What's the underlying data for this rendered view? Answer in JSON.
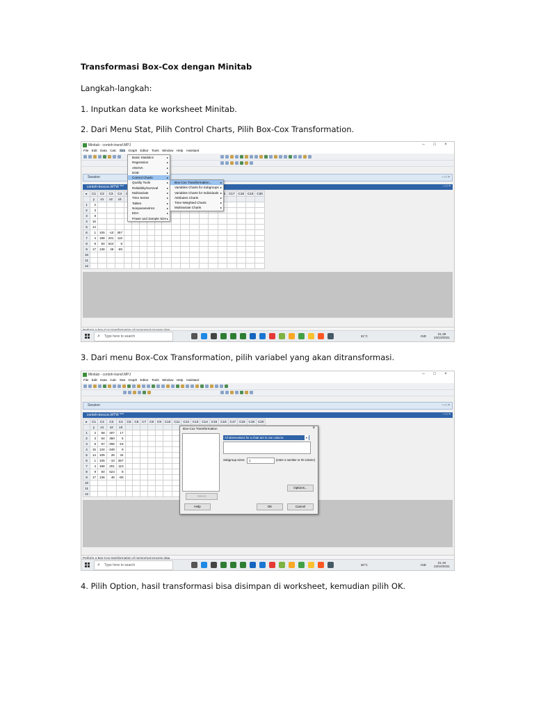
{
  "doc": {
    "title": "Transformasi Box-Cox dengan Minitab",
    "subtitle": "Langkah-langkah:",
    "step1": "1. Inputkan data ke worksheet Minitab.",
    "step2": "2. Dari Menu Stat, Pilih Control Charts, Pilih Box-Cox Transformation.",
    "step3": "3. Dari menu Box-Cox Transformation, pilih variabel yang akan ditransformasi.",
    "step4": "4. Pilih Option, hasil transformasi bisa disimpan di worksheet, kemudian pilih OK."
  },
  "app": {
    "window_title": "Minitab - contoh-transf.MPJ",
    "menu": [
      "File",
      "Edit",
      "Data",
      "Calc",
      "Stat",
      "Graph",
      "Editor",
      "Tools",
      "Window",
      "Help",
      "Assistant"
    ],
    "session_title": "Session",
    "worksheet_title": "contoh-boxcox.MTW ***",
    "status_text": "Perform a Box-Cox transformation of nonnormal process data",
    "search_placeholder": "Type here to search",
    "lang": "IND"
  },
  "screenshot1": {
    "columns": [
      "C1",
      "C2",
      "C3",
      "C4",
      "C5",
      "C6",
      "C7",
      "C8",
      "C9",
      "C10",
      "C11",
      "C12",
      "C13",
      "C14",
      "C15",
      "C16",
      "C17",
      "C18",
      "C19",
      "C20"
    ],
    "col_names": [
      "y",
      "x1",
      "x2",
      "x3"
    ],
    "rows": [
      [
        "1",
        "2",
        "",
        "",
        ""
      ],
      [
        "2",
        "3",
        "",
        "",
        ""
      ],
      [
        "3",
        "8",
        "",
        "",
        ""
      ],
      [
        "4",
        "15",
        "",
        "",
        ""
      ],
      [
        "5",
        "14",
        "",
        "",
        ""
      ],
      [
        "6",
        "1",
        "105",
        "-10",
        "357"
      ],
      [
        "7",
        "4",
        "188",
        "201",
        "110"
      ],
      [
        "8",
        "9",
        "50",
        "524",
        "8"
      ],
      [
        "9",
        "17",
        "136",
        "46",
        "-80"
      ],
      [
        "10",
        "",
        "",
        "",
        ""
      ],
      [
        "11",
        "",
        "",
        "",
        ""
      ],
      [
        "12",
        "",
        "",
        "",
        ""
      ]
    ],
    "stat_menu": [
      "Basic Statistics",
      "Regression",
      "ANOVA",
      "DOE",
      "Control Charts",
      "Quality Tools",
      "Reliability/Survival",
      "Multivariate",
      "Time Series",
      "Tables",
      "Nonparametrics",
      "EDA",
      "Power and Sample Size"
    ],
    "control_charts_menu": [
      "Box-Cox Transformation...",
      "Variables Charts for Subgroups",
      "Variables Charts for Individuals",
      "Attributes Charts",
      "Time-Weighted Charts",
      "Multivariate Charts"
    ],
    "weather": "31°C",
    "time": "01.38",
    "date": "23/10/2021"
  },
  "screenshot2": {
    "rows": [
      [
        "1",
        "2",
        "58",
        "407",
        "17"
      ],
      [
        "2",
        "3",
        "84",
        "360",
        "5"
      ],
      [
        "3",
        "8",
        "87",
        "-306",
        "-15"
      ],
      [
        "4",
        "15",
        "134",
        "-349",
        "9"
      ],
      [
        "5",
        "14",
        "106",
        "26",
        "34"
      ],
      [
        "6",
        "1",
        "105",
        "-10",
        "357"
      ],
      [
        "7",
        "4",
        "188",
        "201",
        "110"
      ],
      [
        "8",
        "9",
        "50",
        "524",
        "8"
      ],
      [
        "9",
        "17",
        "136",
        "46",
        "-80"
      ],
      [
        "10",
        "",
        "",
        "",
        ""
      ],
      [
        "11",
        "",
        "",
        "",
        ""
      ],
      [
        "12",
        "",
        "",
        "",
        ""
      ]
    ],
    "dialog": {
      "title": "Box-Cox Transformation",
      "dropdown_value": "All observations for a chart are in one column:",
      "subgroup_label": "Subgroup sizes:",
      "subgroup_value": "1",
      "subgroup_hint": "(enter a number or ID column)",
      "options_button": "Options...",
      "select_button": "Select",
      "help_button": "Help",
      "ok_button": "OK",
      "cancel_button": "Cancel"
    },
    "weather": "28°C",
    "time": "01.40",
    "date": "23/10/2021"
  },
  "colors": {
    "accent_blue": "#2f63a8",
    "menu_highlight": "#9bc3ef"
  }
}
